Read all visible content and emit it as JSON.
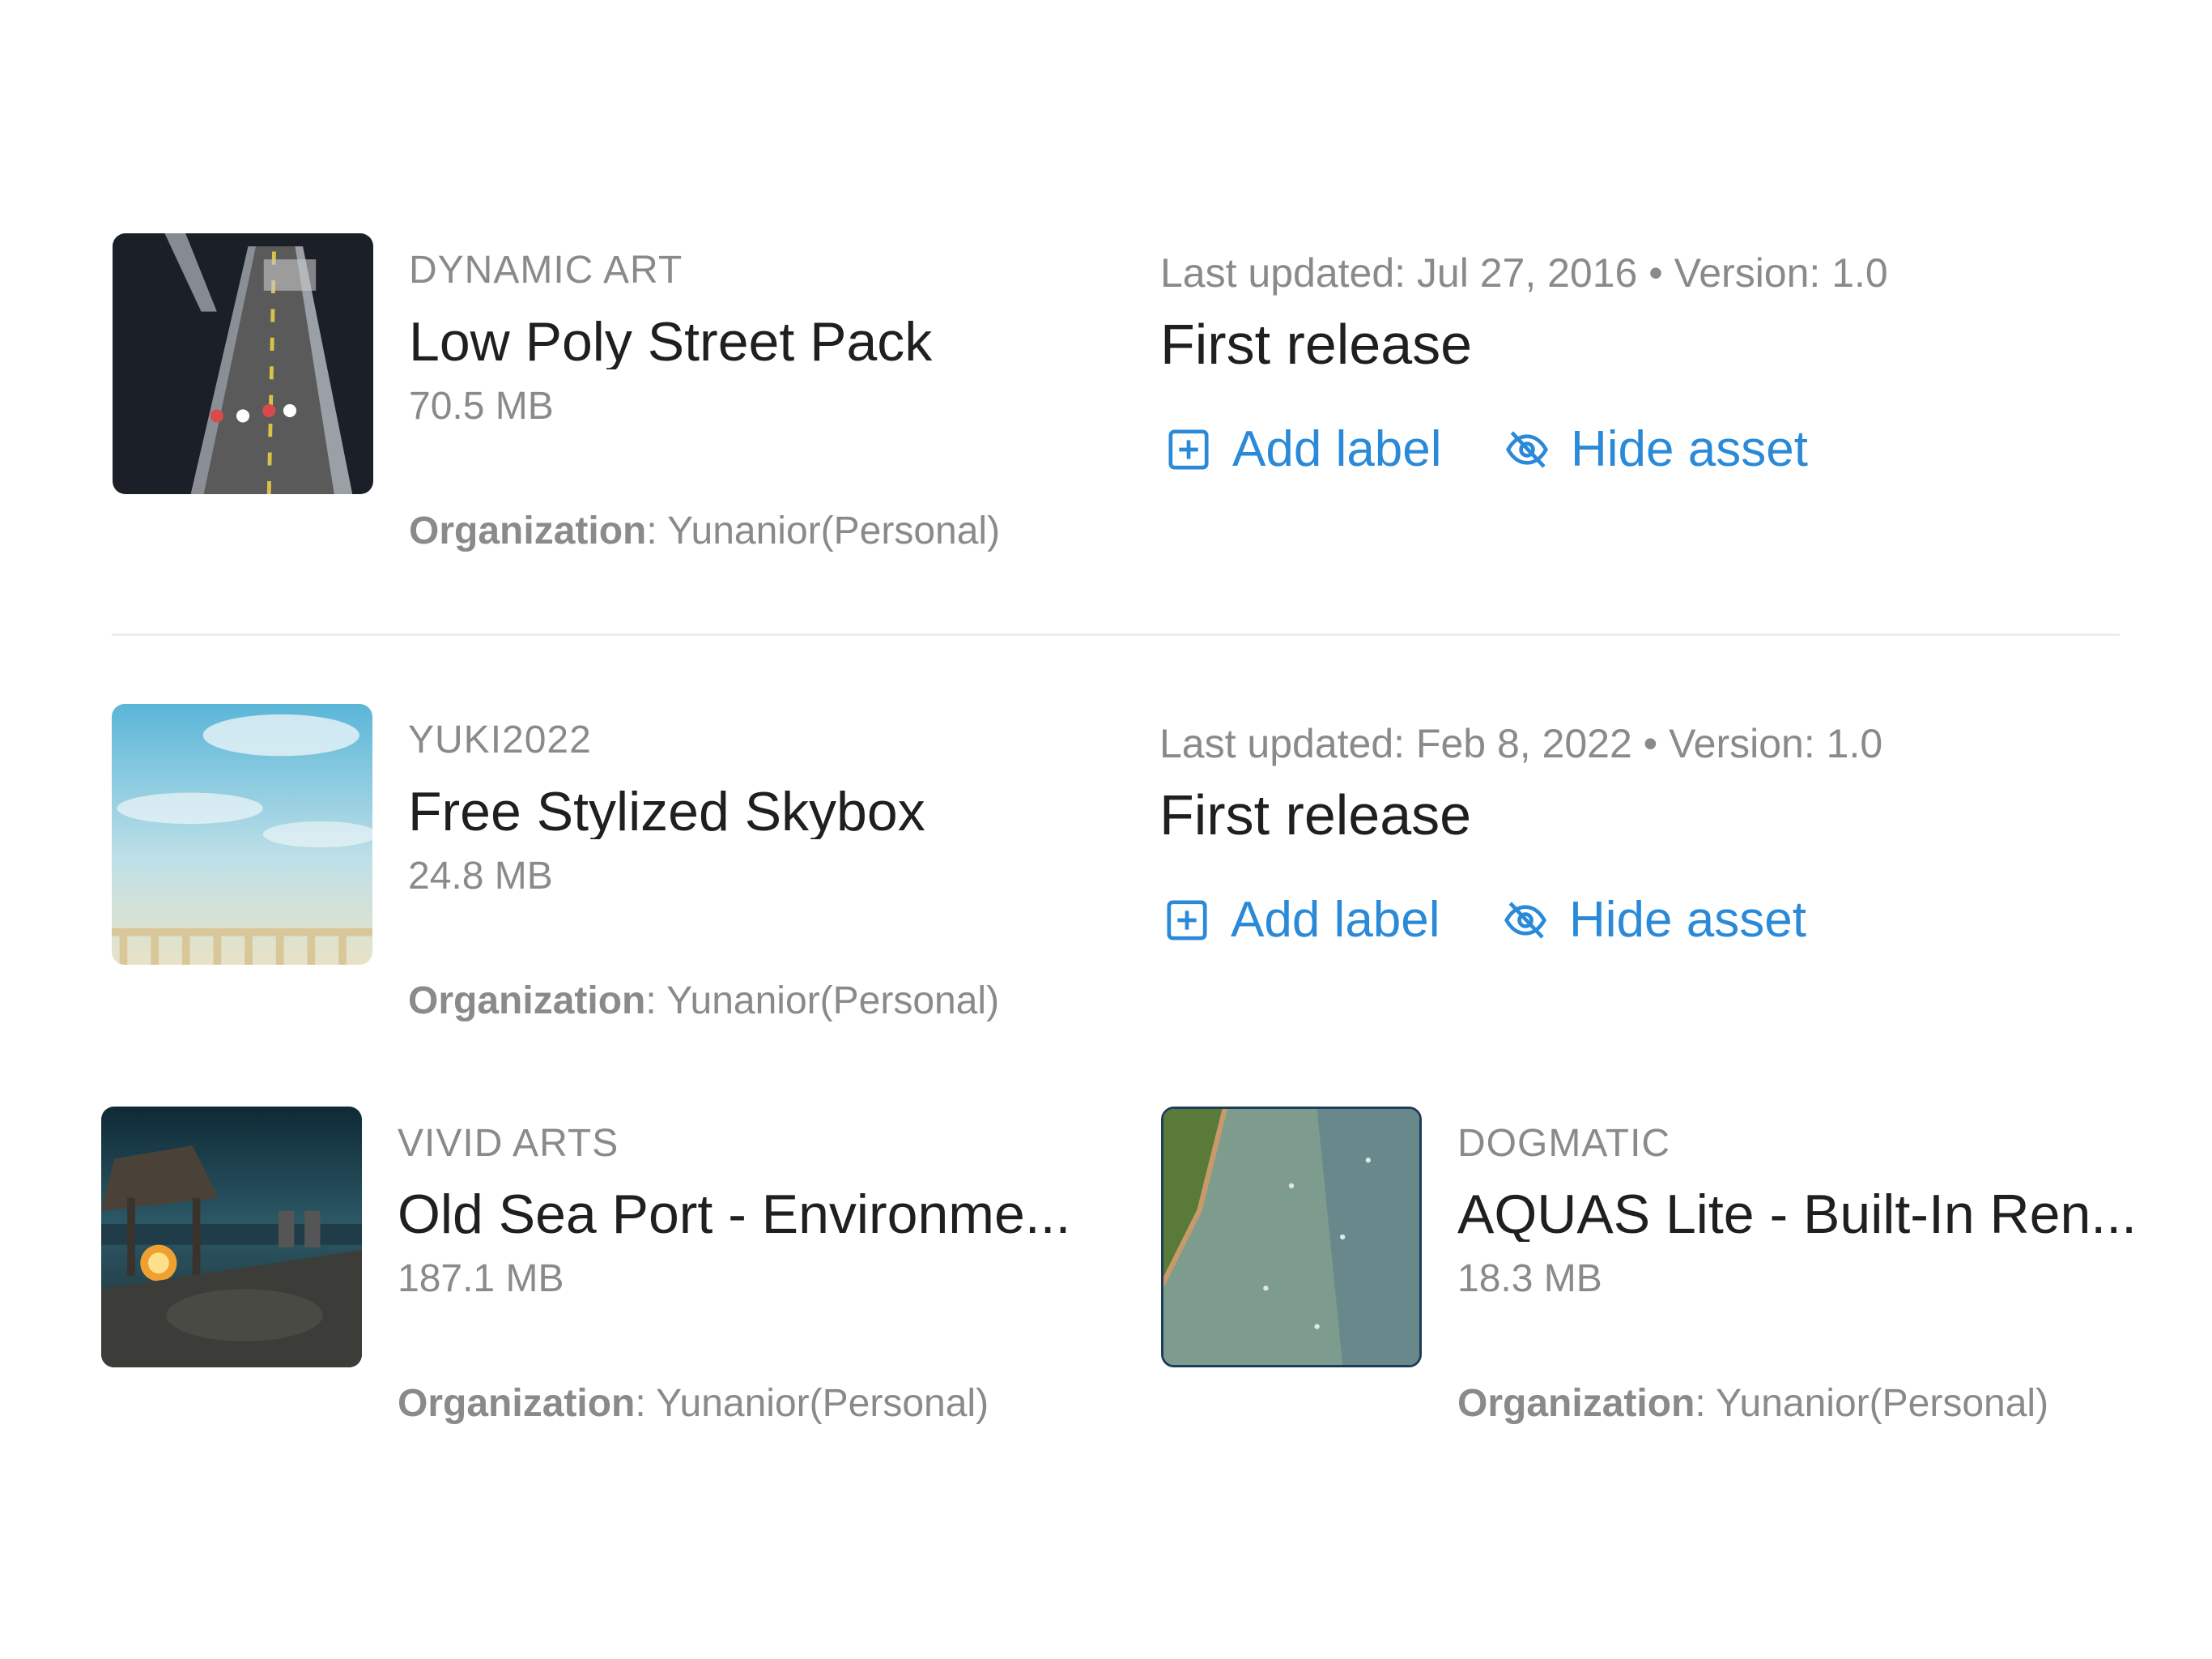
{
  "assets": [
    {
      "publisher": "DYNAMIC ART",
      "title": "Low Poly Street Pack",
      "size": "70.5 MB",
      "org_label": "Organization",
      "org_value": ": Yunanior(Personal)",
      "meta": "Last updated: Jul 27, 2016 • Version: 1.0",
      "release_notes": "First release",
      "add_label": "Add label",
      "hide_asset": "Hide asset"
    },
    {
      "publisher": "YUKI2022",
      "title": "Free Stylized Skybox",
      "size": "24.8 MB",
      "org_label": "Organization",
      "org_value": ": Yunanior(Personal)",
      "meta": "Last updated: Feb 8, 2022 • Version: 1.0",
      "release_notes": "First release",
      "add_label": "Add label",
      "hide_asset": "Hide asset"
    },
    {
      "publisher": "VIVID ARTS",
      "title": "Old Sea Port - Environme...",
      "size": "187.1 MB",
      "org_label": "Organization",
      "org_value": ": Yunanior(Personal)"
    },
    {
      "publisher": "DOGMATIC",
      "title": "AQUAS Lite - Built-In Ren...",
      "size": "18.3 MB",
      "org_label": "Organization",
      "org_value": ": Yunanior(Personal)"
    }
  ],
  "colors": {
    "link": "#2a8ad8",
    "muted": "#8a8a8a",
    "text": "#1f1f1f"
  },
  "icons": [
    "add-box-icon",
    "eye-off-icon"
  ]
}
